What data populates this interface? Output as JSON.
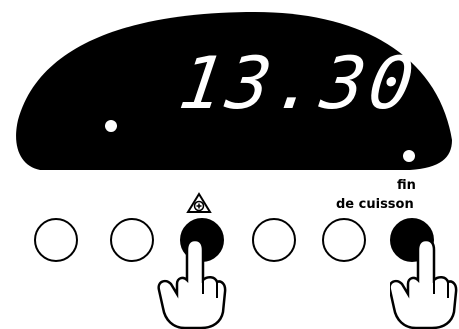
{
  "display": {
    "time": "13.30"
  },
  "controls": {
    "buttons": [
      {
        "name": "button-1",
        "pressed": false
      },
      {
        "name": "button-2",
        "pressed": false
      },
      {
        "name": "plus-button",
        "pressed": true,
        "icon": "plus-triangle-icon"
      },
      {
        "name": "button-4",
        "pressed": false
      },
      {
        "name": "button-5",
        "pressed": false
      },
      {
        "name": "end-of-cooking-button",
        "pressed": true
      }
    ],
    "end_label_line1": "fin",
    "end_label_line2": "de cuisson"
  },
  "colors": {
    "display_bg": "#000000",
    "digits": "#ffffff",
    "outline": "#000000"
  }
}
